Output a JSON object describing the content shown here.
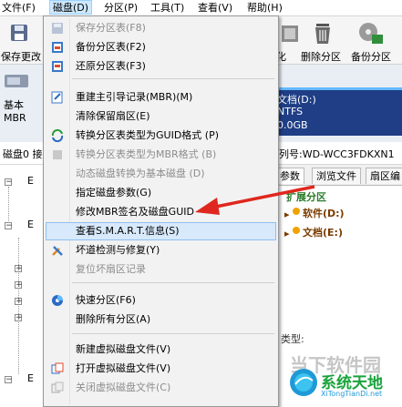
{
  "menubar": {
    "items": [
      "文件(F)",
      "磁盘(D)",
      "分区(P)",
      "工具(T)",
      "查看(V)",
      "帮助(H)"
    ]
  },
  "toolbar": {
    "left_label": "保存更改",
    "items": [
      "化",
      "删除分区",
      "备份分区"
    ]
  },
  "disk_band": {
    "left_lines": [
      "基本",
      "MBR"
    ],
    "partition_name": "文档(D:)",
    "partition_fs": "NTFS",
    "partition_size": "0.0GB"
  },
  "status_line": {
    "left_text": "磁盘0 接",
    "right_text": "列号:WD-WCC3FDKXN1"
  },
  "tabs": [
    "参数",
    "浏览文件",
    "扇区编"
  ],
  "tree_nodes": [
    "E",
    "E",
    "E"
  ],
  "partition_tree": {
    "extended": "扩展分区",
    "items": [
      "软件(D:)",
      "文档(E:)"
    ]
  },
  "content_label": "类型:",
  "disk_menu": {
    "items": [
      {
        "label": "保存分区表(F8)",
        "disabled": true,
        "icon": "save-icon"
      },
      {
        "label": "备份分区表(F2)",
        "disabled": false,
        "icon": "backup-table-icon"
      },
      {
        "label": "还原分区表(F3)",
        "disabled": false,
        "icon": "restore-table-icon"
      },
      {
        "label": "重建主引导记录(MBR)(M)",
        "disabled": false,
        "icon": "rebuild-mbr-icon"
      },
      {
        "label": "清除保留扇区(E)",
        "disabled": false,
        "icon": ""
      },
      {
        "label": "转换分区表类型为GUID格式 (P)",
        "disabled": false,
        "icon": "convert-icon"
      },
      {
        "label": "转换分区表类型为MBR格式 (B)",
        "disabled": true,
        "icon": "convert-mbr-icon"
      },
      {
        "label": "动态磁盘转换为基本磁盘 (D)",
        "disabled": true,
        "icon": ""
      },
      {
        "label": "指定磁盘参数(G)",
        "disabled": false,
        "icon": ""
      },
      {
        "label": "修改MBR签名及磁盘GUID",
        "disabled": false,
        "icon": ""
      },
      {
        "label": "查看S.M.A.R.T.信息(S)",
        "disabled": false,
        "icon": "",
        "highlighted": true
      },
      {
        "label": "坏道检测与修复(Y)",
        "disabled": false,
        "icon": "tools-icon"
      },
      {
        "label": "复位坏扇区记录",
        "disabled": true,
        "icon": ""
      },
      {
        "label": "快速分区(F6)",
        "disabled": false,
        "icon": "quick-partition-icon"
      },
      {
        "label": "删除所有分区(A)",
        "disabled": false,
        "icon": ""
      },
      {
        "label": "新建虚拟磁盘文件(V)",
        "disabled": false,
        "icon": ""
      },
      {
        "label": "打开虚拟磁盘文件(V)",
        "disabled": false,
        "icon": "open-virtual-disk-icon"
      },
      {
        "label": "关闭虚拟磁盘文件(C)",
        "disabled": true,
        "icon": "close-virtual-disk-icon"
      }
    ]
  },
  "watermark": {
    "faint_text": "当下软件园",
    "brand_text": "系统天地",
    "brand_url": "XiTongTianDi.net"
  },
  "colors": {
    "menu_bg": "#f2f2f2",
    "highlight": "#d8e9fb",
    "partition_blue": "#1f3e86",
    "arrow_red": "#e0271f",
    "brand_green": "#1aa33c"
  }
}
